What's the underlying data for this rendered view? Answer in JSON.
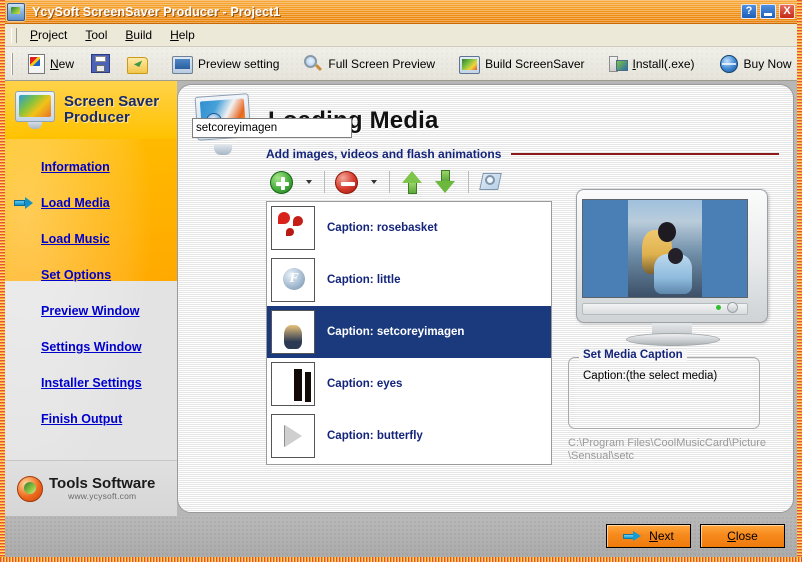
{
  "window": {
    "title": "YcySoft ScreenSaver Producer - Project1",
    "icon": "app-icon",
    "buttons": {
      "help": "?",
      "minimize": "_",
      "close": "X"
    }
  },
  "menu": {
    "items": [
      {
        "label": "Project",
        "accel": "P"
      },
      {
        "label": "Tool",
        "accel": "T"
      },
      {
        "label": "Build",
        "accel": "B"
      },
      {
        "label": "Help",
        "accel": "H"
      }
    ]
  },
  "toolbar": {
    "items": [
      {
        "label": "New",
        "icon": "new-document-icon"
      },
      {
        "label": "",
        "icon": "save-floppy-icon"
      },
      {
        "label": "",
        "icon": "open-folder-icon"
      },
      {
        "label": "Preview setting",
        "icon": "monitor-icon"
      },
      {
        "label": "Full Screen Preview",
        "icon": "magnifier-icon"
      },
      {
        "label": "Build ScreenSaver",
        "icon": "build-monitor-icon"
      },
      {
        "label": "Install(.exe)",
        "icon": "installer-icon"
      },
      {
        "label": "Buy Now",
        "icon": "globe-icon"
      }
    ]
  },
  "sidebar": {
    "product_title_line1": "Screen Saver",
    "product_title_line2": "Producer",
    "logo_icon": "screen-saver-producer-logo",
    "items": [
      {
        "label": "Information",
        "active": false
      },
      {
        "label": "Load Media",
        "active": true
      },
      {
        "label": "Load Music",
        "active": false
      },
      {
        "label": "Set Options",
        "active": false
      },
      {
        "label": "Preview Window",
        "active": false
      },
      {
        "label": "Settings Window",
        "active": false
      },
      {
        "label": "Installer Settings",
        "active": false
      },
      {
        "label": "Finish Output",
        "active": false
      }
    ],
    "footer": {
      "brand": "Tools Software",
      "url": "www.ycysoft.com",
      "logo_icon": "tools-software-logo"
    },
    "colors": {
      "highlight": "#ffc200",
      "inactive": "#e0e0e0",
      "link": "#0000cc"
    }
  },
  "main": {
    "page_title": "Loading Media",
    "page_icon": "loading-media-icon",
    "subtitle": "Add images, videos and flash animations",
    "rule_color": "#8b1a1a",
    "media_toolbar": [
      {
        "name": "add",
        "icon": "add-circle-icon",
        "has_dropdown": true
      },
      {
        "name": "remove",
        "icon": "remove-circle-icon",
        "has_dropdown": true
      },
      {
        "name": "move-up",
        "icon": "arrow-up-icon",
        "has_dropdown": false
      },
      {
        "name": "move-down",
        "icon": "arrow-down-icon",
        "has_dropdown": false
      },
      {
        "name": "properties",
        "icon": "properties-icon",
        "has_dropdown": false
      }
    ],
    "media_items": [
      {
        "caption": "Caption: rosebasket",
        "thumb": "rosebasket-thumb",
        "selected": false
      },
      {
        "caption": "Caption: little",
        "thumb": "flash-file-thumb",
        "selected": false
      },
      {
        "caption": "Caption: setcoreyimagen",
        "thumb": "setcoreyimagen-thumb",
        "selected": true
      },
      {
        "caption": "Caption: eyes",
        "thumb": "eyes-thumb",
        "selected": false
      },
      {
        "caption": "Caption: butterfly",
        "thumb": "butterfly-thumb",
        "selected": false
      }
    ],
    "preview": {
      "icon": "preview-monitor"
    },
    "caption_group": {
      "legend": "Set Media Caption",
      "field_label": "Caption:(the select media)",
      "field_value": "setcoreyimagen",
      "field_placeholder": ""
    },
    "path": "C:\\Program Files\\CoolMusicCard\\Picture\\Sensual\\setc"
  },
  "footer": {
    "next_label": "Next",
    "next_accel": "N",
    "close_label": "Close",
    "close_accel": "C",
    "next_icon": "arrow-right-icon"
  }
}
